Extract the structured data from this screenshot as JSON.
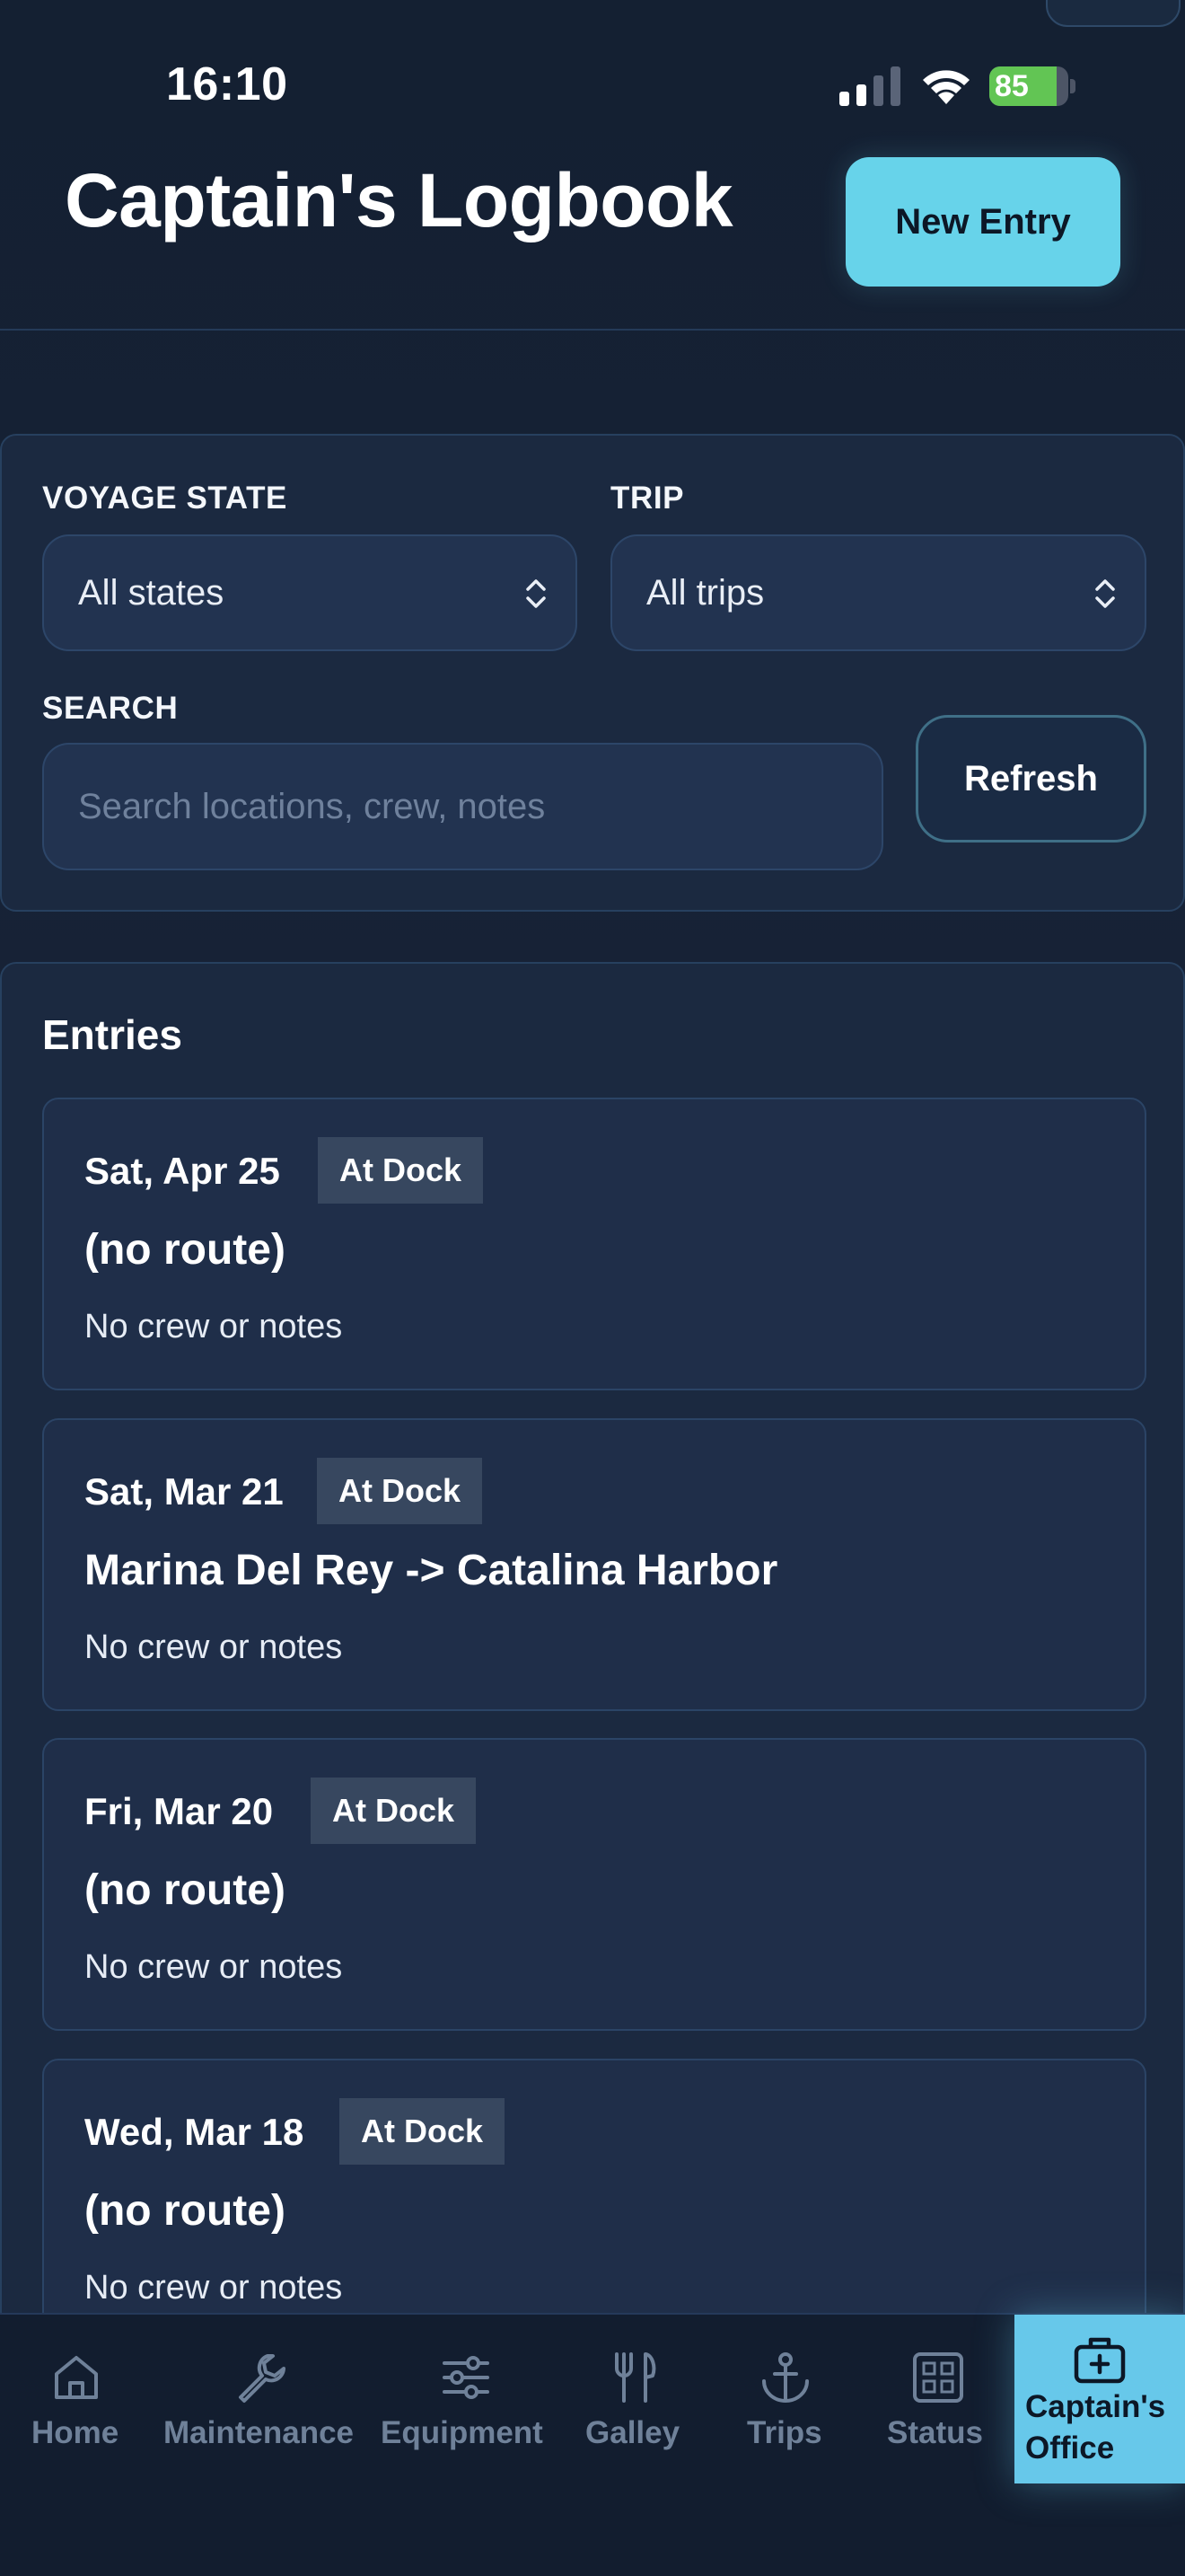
{
  "status_bar": {
    "time": "16:10",
    "battery_level": "85",
    "battery_fraction": 0.85,
    "battery_color": "#62c554"
  },
  "header": {
    "title": "Captain's Logbook",
    "new_entry_label": "New Entry",
    "accent": "#67d3ea"
  },
  "filters": {
    "voyage_state_label": "VOYAGE STATE",
    "voyage_state_value": "All states",
    "trip_label": "TRIP",
    "trip_value": "All trips",
    "search_label": "SEARCH",
    "search_placeholder": "Search locations, crew, notes",
    "search_value": "",
    "refresh_label": "Refresh"
  },
  "entries": {
    "title": "Entries",
    "items": [
      {
        "date": "Sat, Apr 25",
        "badge": "At Dock",
        "route": "(no route)",
        "notes": "No crew or notes"
      },
      {
        "date": "Sat, Mar 21",
        "badge": "At Dock",
        "route": "Marina Del Rey -> Catalina Harbor",
        "notes": "No crew or notes"
      },
      {
        "date": "Fri, Mar 20",
        "badge": "At Dock",
        "route": "(no route)",
        "notes": "No crew or notes"
      },
      {
        "date": "Wed, Mar 18",
        "badge": "At Dock",
        "route": "(no route)",
        "notes": "No crew or notes"
      }
    ]
  },
  "nav": {
    "items": [
      {
        "label": "Home",
        "icon": "home-icon"
      },
      {
        "label": "Maintenance",
        "icon": "wrench-icon"
      },
      {
        "label": "Equipment",
        "icon": "sliders-icon"
      },
      {
        "label": "Galley",
        "icon": "fork-knife-icon"
      },
      {
        "label": "Trips",
        "icon": "anchor-icon"
      },
      {
        "label": "Status",
        "icon": "grid-icon"
      },
      {
        "label": "Captain's Office",
        "icon": "briefcase-medical-icon",
        "active": true
      }
    ]
  }
}
